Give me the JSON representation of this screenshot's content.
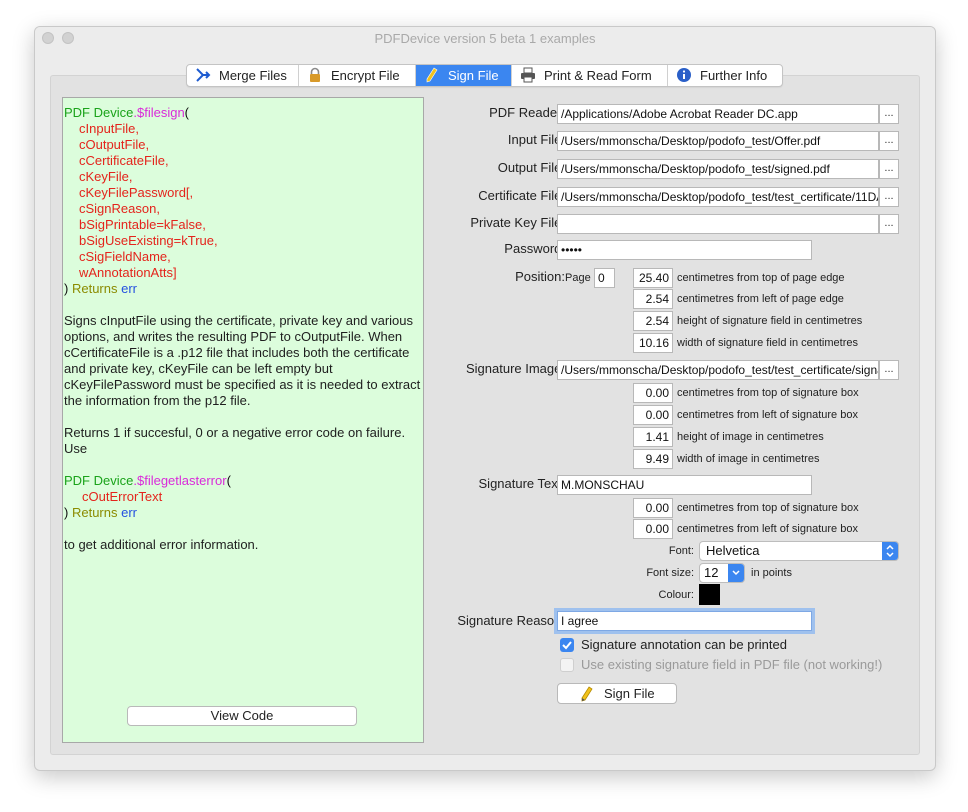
{
  "window": {
    "title": "PDFDevice version 5 beta 1 examples"
  },
  "tabs": [
    {
      "label": "Merge Files",
      "icon": "merge-icon"
    },
    {
      "label": "Encrypt File",
      "icon": "lock-icon"
    },
    {
      "label": "Sign File",
      "icon": "pen-icon"
    },
    {
      "label": "Print & Read Form",
      "icon": "printer-icon"
    },
    {
      "label": "Further Info",
      "icon": "info-icon"
    }
  ],
  "active_tab": "Sign File",
  "code": {
    "fn1_class": "PDF Device",
    "fn1_name": ".$filesign",
    "paren_open": "(",
    "params": [
      "cInputFile,",
      "cOutputFile,",
      "cCertificateFile,",
      "cKeyFile,",
      "cKeyFilePassword[,",
      "cSignReason,",
      "bSigPrintable=kFalse,",
      "bSigUseExisting=kTrue,",
      "cSigFieldName,",
      "wAnnotationAtts]"
    ],
    "close_paren": ")",
    "returns": "Returns",
    "err": "err",
    "description": "Signs cInputFile using the certificate, private key and various options, and writes the resulting PDF to cOutputFile. When cCertificateFile is a .p12 file that includes both the certificate and private key, cKeyFile can be left empty but cKeyFilePassword must be specified as it is needed to extract the information from the p12 file.",
    "returns_desc": "Returns 1 if succesful, 0 or a negative error code on failure. Use",
    "fn2_class": "PDF Device",
    "fn2_name": ".$filegetlasterror",
    "fn2_param": "cOutErrorText",
    "footer": "to get additional error information.",
    "view_code_label": "View Code"
  },
  "form": {
    "pdf_reader": {
      "label": "PDF Reader:",
      "value": "/Applications/Adobe Acrobat Reader DC.app"
    },
    "input_file": {
      "label": "Input File:",
      "value": "/Users/mmonscha/Desktop/podofo_test/Offer.pdf"
    },
    "output_file": {
      "label": "Output File:",
      "value": "/Users/mmonscha/Desktop/podofo_test/signed.pdf"
    },
    "certificate_file": {
      "label": "Certificate File:",
      "value": "/Users/mmonscha/Desktop/podofo_test/test_certificate/11DA"
    },
    "private_key_file": {
      "label": "Private Key File:",
      "value": ""
    },
    "password": {
      "label": "Password:",
      "value": "•••••"
    },
    "browse_label": "...",
    "position": {
      "label": "Position:",
      "page_label": "Page",
      "page_value": "0",
      "rows": [
        {
          "value": "25.40",
          "desc": "centimetres from top of page edge"
        },
        {
          "value": "2.54",
          "desc": "centimetres from left of page edge"
        },
        {
          "value": "2.54",
          "desc": "height of signature field in centimetres"
        },
        {
          "value": "10.16",
          "desc": "width of signature field in centimetres"
        }
      ]
    },
    "signature_image": {
      "label": "Signature Image:",
      "value": "/Users/mmonscha/Desktop/podofo_test/test_certificate/signa",
      "rows": [
        {
          "value": "0.00",
          "desc": "centimetres from top of signature box"
        },
        {
          "value": "0.00",
          "desc": "centimetres from left of signature box"
        },
        {
          "value": "1.41",
          "desc": "height of image in centimetres"
        },
        {
          "value": "9.49",
          "desc": "width of image in centimetres"
        }
      ]
    },
    "signature_text": {
      "label": "Signature Text:",
      "value": "M.MONSCHAU",
      "rows": [
        {
          "value": "0.00",
          "desc": "centimetres from top of signature box"
        },
        {
          "value": "0.00",
          "desc": "centimetres from left of signature box"
        }
      ],
      "font_label": "Font:",
      "font_value": "Helvetica",
      "font_size_label": "Font size:",
      "font_size_value": "12",
      "font_size_unit": "in points",
      "colour_label": "Colour:",
      "colour_value": "#000000"
    },
    "signature_reason": {
      "label": "Signature Reason:",
      "value": "I agree"
    },
    "chk_printable": {
      "label": "Signature annotation can be printed",
      "checked": true
    },
    "chk_existing": {
      "label": "Use existing signature field in PDF file (not working!)",
      "checked": false
    },
    "sign_button_label": "Sign File"
  },
  "colors": {
    "accent": "#3b86f0",
    "code_bg": "#dcfddc"
  }
}
